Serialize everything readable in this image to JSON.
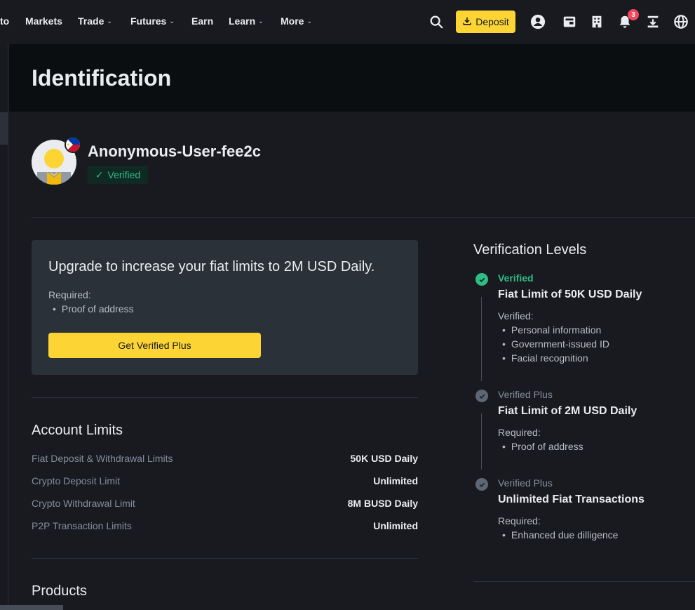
{
  "nav": {
    "partial_item": "to",
    "items": [
      {
        "label": "Markets",
        "has_chevron": false
      },
      {
        "label": "Trade",
        "has_chevron": true
      },
      {
        "label": "Futures",
        "has_chevron": true
      },
      {
        "label": "Earn",
        "has_chevron": false
      },
      {
        "label": "Learn",
        "has_chevron": true
      },
      {
        "label": "More",
        "has_chevron": true
      }
    ],
    "deposit_label": "Deposit",
    "notification_count": "3",
    "chevron_glyph": "⌄"
  },
  "page": {
    "title": "Identification"
  },
  "profile": {
    "username": "Anonymous-User-fee2c",
    "status": "Verified",
    "check_glyph": "✓"
  },
  "upgrade": {
    "title": "Upgrade to increase your fiat limits to 2M USD Daily.",
    "required_label": "Required:",
    "requirements": [
      "Proof of address"
    ],
    "button_label": "Get Verified Plus"
  },
  "account_limits": {
    "title": "Account Limits",
    "rows": [
      {
        "label": "Fiat Deposit & Withdrawal Limits",
        "value": "50K USD Daily"
      },
      {
        "label": "Crypto Deposit Limit",
        "value": "Unlimited"
      },
      {
        "label": "Crypto Withdrawal Limit",
        "value": "8M BUSD Daily"
      },
      {
        "label": "P2P Transaction Limits",
        "value": "Unlimited"
      }
    ]
  },
  "products": {
    "title": "Products"
  },
  "verification_levels": {
    "title": "Verification Levels",
    "levels": [
      {
        "status": "Verified",
        "headline": "Fiat Limit of 50K USD Daily",
        "list_label": "Verified:",
        "items": [
          "Personal information",
          "Government-issued ID",
          "Facial recognition"
        ],
        "complete": true
      },
      {
        "status": "Verified Plus",
        "headline": "Fiat Limit of 2M USD Daily",
        "list_label": "Required:",
        "items": [
          "Proof of address"
        ],
        "complete": false
      },
      {
        "status": "Verified Plus",
        "headline": "Unlimited Fiat Transactions",
        "list_label": "Required:",
        "items": [
          "Enhanced due dilligence"
        ],
        "complete": false
      }
    ]
  },
  "colors": {
    "background": "#181a20",
    "header_bg": "#0b0e11",
    "card_bg": "#2b3139",
    "accent_yellow": "#fcd535",
    "success_green": "#2ebd85",
    "badge_red": "#f6465d",
    "muted_text": "#848e9c"
  },
  "icons": {
    "search": "search-icon",
    "deposit": "download-icon",
    "account": "user-circle-icon",
    "orders": "wallet-icon",
    "tax": "building-icon",
    "notifications": "bell-icon",
    "downloads": "download-app-icon",
    "language": "globe-icon"
  }
}
